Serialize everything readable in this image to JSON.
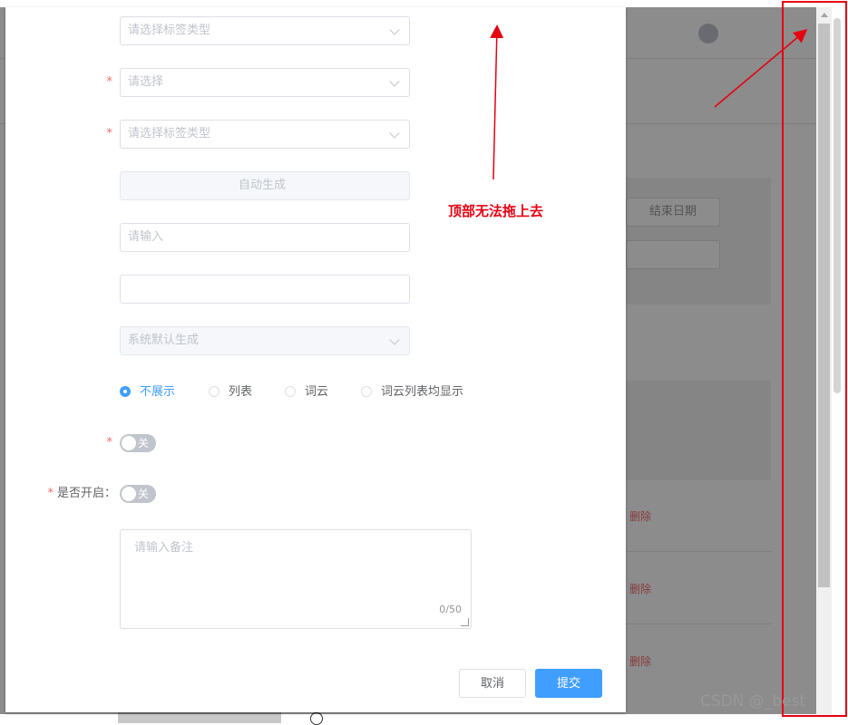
{
  "background": {
    "end_date_label": "结束日期",
    "delete_label": "删除"
  },
  "form": {
    "tag_type": {
      "placeholder": "请选择标签类型"
    },
    "field2": {
      "placeholder": "请选择"
    },
    "field3": {
      "placeholder": "请选择标签类型"
    },
    "field4": {
      "value": "自动生成"
    },
    "field5": {
      "placeholder": "请输入"
    },
    "field6": {
      "value": ""
    },
    "field7": {
      "value": "系统默认生成"
    },
    "display_mode": {
      "options": [
        "不展示",
        "列表",
        "词云",
        "词云列表均显示"
      ],
      "selected": "不展示"
    },
    "switch1": {
      "text": "关"
    },
    "switch2": {
      "label": "是否开启：",
      "text": "关"
    },
    "remark": {
      "placeholder": "请输入备注",
      "count": "0/50"
    }
  },
  "footer": {
    "cancel_label": "取消",
    "submit_label": "提交"
  },
  "annotation": {
    "note": "顶部无法拖上去"
  },
  "watermark": "CSDN @_best",
  "colors": {
    "primary": "#409eff",
    "annotation_red": "#e60012"
  }
}
